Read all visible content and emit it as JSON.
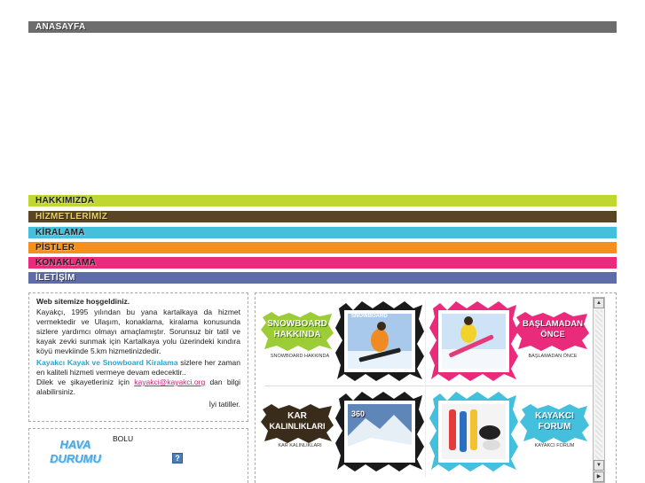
{
  "nav": {
    "home": "ANASAYFA",
    "items": [
      "HAKKIMIZDA",
      "HİZMETLERİMİZ",
      "KİRALAMA",
      "PİSTLER",
      "KONAKLAMA",
      "İLETİŞİM"
    ]
  },
  "colors": {
    "home": "#6d6d6d",
    "hakkimizda": "#bfd730",
    "hizmetler": "#5a4524",
    "kiralama": "#45c0dc",
    "pistler": "#f5901f",
    "konaklama": "#ea2a7b",
    "iletisim": "#5e6ca9"
  },
  "welcome": {
    "title": "Web sitemize hoşgeldiniz.",
    "p1": "Kayakçı, 1995 yılından bu yana kartalkaya da hizmet vermektedir ve Ulaşım, konaklama, kiralama konusunda sizlere yardımcı olmayı amaçlamıştır. Sorunsuz bir tatil ve kayak zevki sunmak için Kartalkaya yolu üzerindeki kındıra köyü mevkiinde 5.km hizmetinizdedir.",
    "p2_link": "Kayakcı Kayak ve Snowboard Kiralama",
    "p2_rest": " sizlere her zaman en kaliteli hizmeti vermeye devam edecektir..",
    "p3_a": "Dilek ve şikayetleriniz için ",
    "p3_email": "kayakci@kayakci.org",
    "p3_b": " dan bilgi alabilirsiniz.",
    "sign": "İyi tatiller."
  },
  "weather": {
    "logo_line1": "HAVA",
    "logo_line2": "DURUMU",
    "city": "BOLU",
    "icon_glyph": "?"
  },
  "gallery": {
    "t1_badge_1": "SNOWBOARD",
    "t1_badge_2": "HAKKINDA",
    "t1_caption": "SNOWBOARD HAKKINDA",
    "t1_photo_label": "SNOWBOARD",
    "t2_badge_1": "BAŞLAMADAN",
    "t2_badge_2": "ÖNCE",
    "t2_caption": "BAŞLAMADAN ÖNCE",
    "t3_badge_1": "KAR",
    "t3_badge_2": "KALINLIKLARI",
    "t3_caption": "KAR KALINLIKLARI",
    "t3_photo_label": "360",
    "t4_badge_1": "KAYAKCI",
    "t4_badge_2": "FORUM",
    "t4_caption": "KAYAKCI FORUM"
  }
}
